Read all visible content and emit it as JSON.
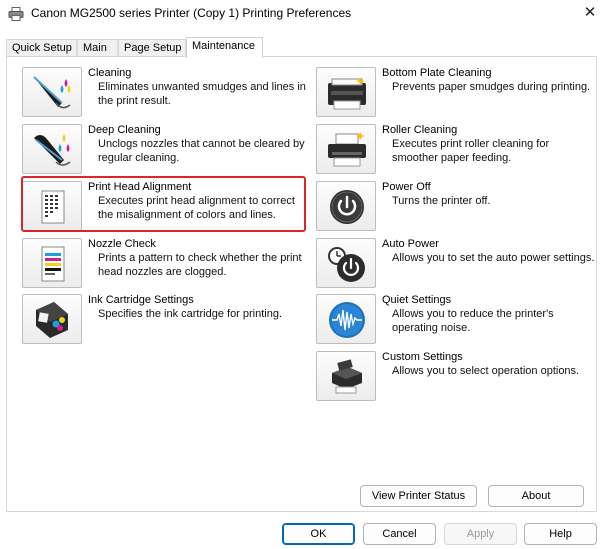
{
  "window": {
    "title": "Canon MG2500 series Printer (Copy 1) Printing Preferences",
    "close_symbol": "✕"
  },
  "tabs": [
    {
      "label": "Quick Setup",
      "active": false
    },
    {
      "label": "Main",
      "active": false
    },
    {
      "label": "Page Setup",
      "active": false
    },
    {
      "label": "Maintenance",
      "active": true
    }
  ],
  "left_items": [
    {
      "name": "Cleaning",
      "desc": "Eliminates unwanted smudges and lines in the print result.",
      "icon": "cleaning-icon"
    },
    {
      "name": "Deep Cleaning",
      "desc": "Unclogs nozzles that cannot be cleared by regular cleaning.",
      "icon": "deep-cleaning-icon"
    },
    {
      "name": "Print Head Alignment",
      "desc": "Executes print head alignment to correct the misalignment of colors and lines.",
      "icon": "print-head-alignment-icon",
      "highlighted": true
    },
    {
      "name": "Nozzle Check",
      "desc": "Prints a pattern to check whether the print head nozzles are clogged.",
      "icon": "nozzle-check-icon"
    },
    {
      "name": "Ink Cartridge Settings",
      "desc": "Specifies the ink cartridge for printing.",
      "icon": "ink-cartridge-icon"
    }
  ],
  "right_items": [
    {
      "name": "Bottom Plate Cleaning",
      "desc": "Prevents paper smudges during printing.",
      "icon": "bottom-plate-cleaning-icon"
    },
    {
      "name": "Roller Cleaning",
      "desc": "Executes print roller cleaning for smoother paper feeding.",
      "icon": "roller-cleaning-icon"
    },
    {
      "name": "Power Off",
      "desc": "Turns the printer off.",
      "icon": "power-off-icon"
    },
    {
      "name": "Auto Power",
      "desc": "Allows you to set the auto power settings.",
      "icon": "auto-power-icon"
    },
    {
      "name": "Quiet Settings",
      "desc": "Allows you to reduce the printer's operating noise.",
      "icon": "quiet-settings-icon"
    },
    {
      "name": "Custom Settings",
      "desc": "Allows you to select operation options.",
      "icon": "custom-settings-icon"
    }
  ],
  "panel_buttons": {
    "view_status": "View Printer Status",
    "about": "About"
  },
  "dialog_buttons": {
    "ok": "OK",
    "cancel": "Cancel",
    "apply": "Apply",
    "help": "Help"
  },
  "colors": {
    "highlight": "#d9262a",
    "ok_border": "#0067c0"
  }
}
